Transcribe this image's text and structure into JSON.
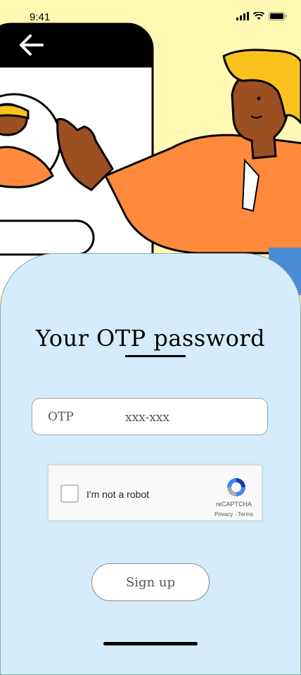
{
  "status_bar": {
    "time": "9:41",
    "icons": [
      "signal-icon",
      "wifi-icon",
      "battery-icon"
    ]
  },
  "header": {
    "back_icon": "arrow-left-icon"
  },
  "main": {
    "title": "Your OTP password",
    "otp_field": {
      "label": "OTP",
      "placeholder": "xxx-xxx"
    },
    "captcha": {
      "label": "I'm not a robot",
      "brand": "reCAPTCHA",
      "links": "Privacy - Terms"
    },
    "signup_label": "Sign up"
  },
  "colors": {
    "background": "#fff9b3",
    "sheet": "#d4ecfb",
    "accent_orange": "#ff8a3d",
    "hair_yellow": "#fbc21d",
    "skin": "#9c4f22"
  }
}
